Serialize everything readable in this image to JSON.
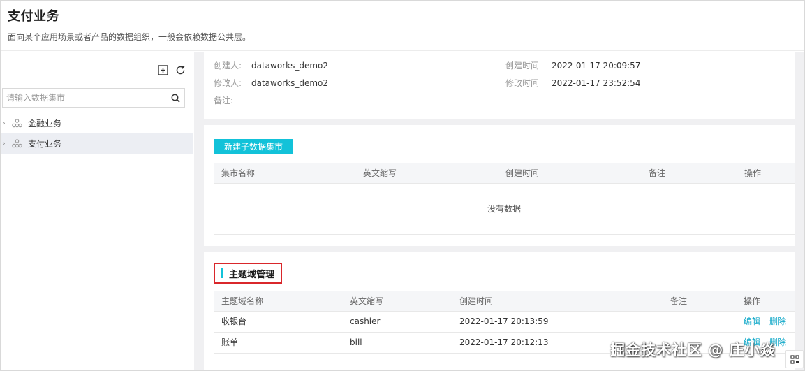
{
  "header": {
    "title": "支付业务",
    "subtitle": "面向某个应用场景或者产品的数据组织，一般会依赖数据公共层。"
  },
  "sidebar": {
    "search_placeholder": "请输入数据集市",
    "tools": [
      "add-icon",
      "refresh-icon"
    ],
    "items": [
      {
        "label": "金融业务",
        "icon": "data-mart-icon",
        "active": false
      },
      {
        "label": "支付业务",
        "icon": "data-mart-icon",
        "active": true
      }
    ]
  },
  "info": {
    "creator_label": "创建人:",
    "creator_value": "dataworks_demo2",
    "modifier_label": "修改人:",
    "modifier_value": "dataworks_demo2",
    "note_label": "备注:",
    "created_time_label": "创建时间",
    "created_time_value": "2022-01-17 20:09:57",
    "modified_time_label": "修改时间",
    "modified_time_value": "2022-01-17 23:52:54"
  },
  "mart_section": {
    "new_button": "新建子数据集市",
    "columns": [
      "集市名称",
      "英文缩写",
      "创建时间",
      "备注",
      "操作"
    ],
    "empty_text": "没有数据"
  },
  "domain_section": {
    "title": "主题域管理",
    "columns": [
      "主题域名称",
      "英文缩写",
      "创建时间",
      "备注",
      "操作"
    ],
    "rows": [
      {
        "name": "收银台",
        "abbr": "cashier",
        "created": "2022-01-17 20:13:59",
        "note": "",
        "edit": "编辑",
        "delete": "删除"
      },
      {
        "name": "账单",
        "abbr": "bill",
        "created": "2022-01-17 20:12:13",
        "note": "",
        "edit": "编辑",
        "delete": "删除"
      }
    ]
  },
  "watermark": "掘金技术社区 @ 庄小焱",
  "colors": {
    "accent": "#12c2d9",
    "link": "#12a9c9",
    "highlight_border": "#d9272b"
  }
}
